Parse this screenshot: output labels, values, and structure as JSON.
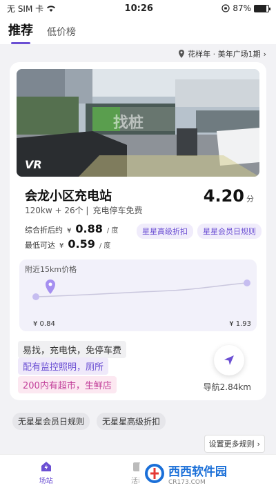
{
  "status_bar": {
    "carrier": "无 SIM 卡",
    "time": "10:26",
    "battery_pct": "87%",
    "battery_level": 0.87
  },
  "tabs": [
    {
      "label": "推荐",
      "active": true
    },
    {
      "label": "低价榜",
      "active": false
    }
  ],
  "location": {
    "text": "花样年 · 美年广场1期",
    "chevron": "›"
  },
  "station": {
    "photo_badge": "VR",
    "photo_watermark": "找桩",
    "name": "会龙小区充电站",
    "power": "120kw + 26个 |",
    "parking": "充电停车免费",
    "score": "4.20",
    "score_unit": "分"
  },
  "prices": {
    "after_discount": {
      "label": "综合折后约",
      "currency": "¥",
      "value": "0.88",
      "unit": "/ 度"
    },
    "lowest": {
      "label": "最低可达",
      "currency": "¥",
      "value": "0.59",
      "unit": "/ 度"
    }
  },
  "tags": [
    "星星高级折扣",
    "星星会员日规则"
  ],
  "price_chart": {
    "title": "附近15km价格",
    "min_label": "¥ 0.84",
    "max_label": "¥ 1.93",
    "min": 0.84,
    "max": 1.93
  },
  "features": [
    "易找，充电快，免停车费",
    "配有监控照明，厕所",
    "200内有超市，生鲜店"
  ],
  "navigation": {
    "label": "导航2.84km"
  },
  "chips": [
    "无星星会员日规则",
    "无星星高级折扣"
  ],
  "more_rules": {
    "label": "设置更多规则",
    "chevron": "›"
  },
  "bottom_nav": [
    {
      "label": "场站",
      "icon": "charging-station-icon",
      "active": true
    },
    {
      "label": "活动",
      "icon": "activity-icon",
      "active": false
    },
    {
      "label": "我的",
      "icon": "profile-icon",
      "active": false
    }
  ],
  "watermark": {
    "main": "西西软件园",
    "sub": "CR173.COM"
  },
  "colors": {
    "accent": "#6b4fd3",
    "tag_bg": "#f0ecfb",
    "pink": "#c2409a"
  }
}
